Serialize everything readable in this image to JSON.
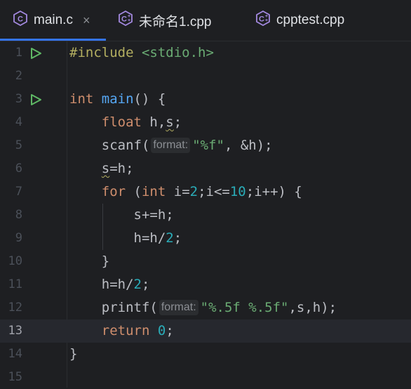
{
  "tabs": [
    {
      "label": "main.c",
      "icon": "c-file-icon",
      "active": true,
      "close": "×"
    },
    {
      "label": "未命名1.cpp",
      "icon": "cpp-file-icon",
      "active": false
    },
    {
      "label": "cpptest.cpp",
      "icon": "cpp-file-icon",
      "active": false
    }
  ],
  "editor": {
    "current_line": 13,
    "hint_label": "format:",
    "line_numbers": [
      "1",
      "2",
      "3",
      "4",
      "5",
      "6",
      "7",
      "8",
      "9",
      "10",
      "11",
      "12",
      "13",
      "14",
      "15"
    ],
    "lines": {
      "l1": {
        "a": "#include",
        "b": " <stdio.h>"
      },
      "l3": {
        "a": "int",
        "b": " ",
        "c": "main",
        "d": "() {"
      },
      "l4": {
        "a": "float",
        "b": " h,",
        "c": "s",
        "d": ";"
      },
      "l5": {
        "a": "scanf(",
        "b": "\"%f\"",
        "c": ", &h);"
      },
      "l6": {
        "a": "s",
        "b": "=h;"
      },
      "l7": {
        "a": "for",
        "b": " (",
        "c": "int",
        "d": " i=",
        "e": "2",
        "f": ";i<=",
        "g": "10",
        "h": ";i++) {"
      },
      "l8": {
        "a": "s+=h;"
      },
      "l9": {
        "a": "h=h/",
        "b": "2",
        "c": ";"
      },
      "l10": {
        "a": "}"
      },
      "l11": {
        "a": "h=h/",
        "b": "2",
        "c": ";"
      },
      "l12": {
        "a": "printf(",
        "b": "\"%.5f %.5f\"",
        "c": ",s,h);"
      },
      "l13": {
        "a": "return",
        "b": " ",
        "c": "0",
        "d": ";"
      },
      "l14": {
        "a": "}"
      }
    }
  },
  "colors": {
    "accent": "#3574f0",
    "keyword": "#cf8e6d",
    "function": "#56a8f5",
    "number": "#2aacb8",
    "string": "#6aab73",
    "run": "#5fb865"
  }
}
